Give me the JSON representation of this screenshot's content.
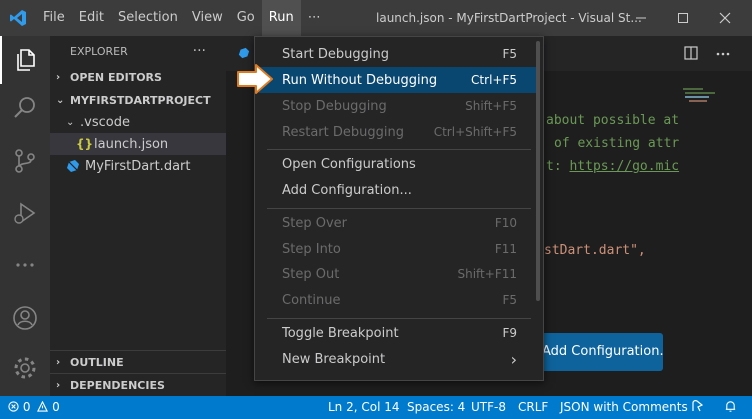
{
  "titlebar": {
    "menus": [
      "File",
      "Edit",
      "Selection",
      "View",
      "Go",
      "Run",
      "⋯"
    ],
    "window_title": "launch.json - MyFirstDartProject - Visual St..."
  },
  "sidebar": {
    "header": "EXPLORER",
    "more": "···",
    "open_editors": "OPEN EDITORS",
    "project": "MYFIRSTDARTPROJECT",
    "vscode_folder": ".vscode",
    "launch_json_icon": "{}",
    "launch_json": "launch.json",
    "dart_file": "MyFirstDart.dart",
    "outline": "OUTLINE",
    "dependencies": "DEPENDENCIES"
  },
  "editor": {
    "line1": "about possible at",
    "line2": "of existing attr",
    "line3_prefix": "t: ",
    "line3_link": "https://go.mic",
    "line4": "stDart.dart\",",
    "add_config_button": "Add Configuration..."
  },
  "run_menu": {
    "items": [
      {
        "label": "Start Debugging",
        "key": "F5"
      },
      {
        "label": "Run Without Debugging",
        "key": "Ctrl+F5"
      },
      {
        "label": "Stop Debugging",
        "key": "Shift+F5"
      },
      {
        "label": "Restart Debugging",
        "key": "Ctrl+Shift+F5"
      },
      {
        "label": "Open Configurations",
        "key": ""
      },
      {
        "label": "Add Configuration...",
        "key": ""
      },
      {
        "label": "Step Over",
        "key": "F10"
      },
      {
        "label": "Step Into",
        "key": "F11"
      },
      {
        "label": "Step Out",
        "key": "Shift+F11"
      },
      {
        "label": "Continue",
        "key": "F5"
      },
      {
        "label": "Toggle Breakpoint",
        "key": "F9"
      },
      {
        "label": "New Breakpoint",
        "key": "›"
      }
    ]
  },
  "statusbar": {
    "errors": "0",
    "warnings": "0",
    "position": "Ln 2, Col 14",
    "spaces": "Spaces: 4",
    "encoding": "UTF-8",
    "eol": "CRLF",
    "language": "JSON with Comments"
  },
  "colors": {
    "accent": "#007acc",
    "menu_highlight": "#094771",
    "button": "#0e639c"
  }
}
